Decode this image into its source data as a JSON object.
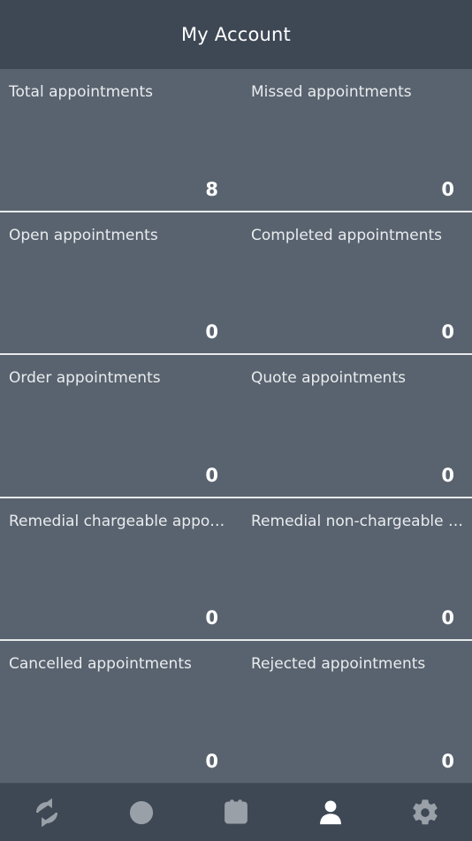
{
  "header": {
    "title": "My Account"
  },
  "stats": {
    "rows": [
      {
        "left": {
          "label": "Total appointments",
          "value": "8"
        },
        "right": {
          "label": "Missed appointments",
          "value": "0"
        }
      },
      {
        "left": {
          "label": "Open appointments",
          "value": "0"
        },
        "right": {
          "label": "Completed appointments",
          "value": "0"
        }
      },
      {
        "left": {
          "label": "Order appointments",
          "value": "0"
        },
        "right": {
          "label": "Quote appointments",
          "value": "0"
        }
      },
      {
        "left": {
          "label": "Remedial chargeable appoi…",
          "value": "0"
        },
        "right": {
          "label": "Remedial non-chargeable a…",
          "value": "0"
        }
      },
      {
        "left": {
          "label": "Cancelled appointments",
          "value": "0"
        },
        "right": {
          "label": "Rejected appointments",
          "value": "0"
        }
      }
    ]
  },
  "navbar": {
    "items": [
      {
        "icon": "sync-icon",
        "active": false
      },
      {
        "icon": "clock-icon",
        "active": false
      },
      {
        "icon": "calendar-icon",
        "active": false
      },
      {
        "icon": "person-icon",
        "active": true
      },
      {
        "icon": "gear-icon",
        "active": false
      }
    ]
  },
  "colors": {
    "header_background": "#3e4855",
    "card_background": "#59636f",
    "divider": "#e8eaec",
    "label_text": "#e9ecee",
    "value_text": "#ffffff",
    "icon_inactive": "#9aa0a8",
    "icon_active": "#ffffff"
  }
}
